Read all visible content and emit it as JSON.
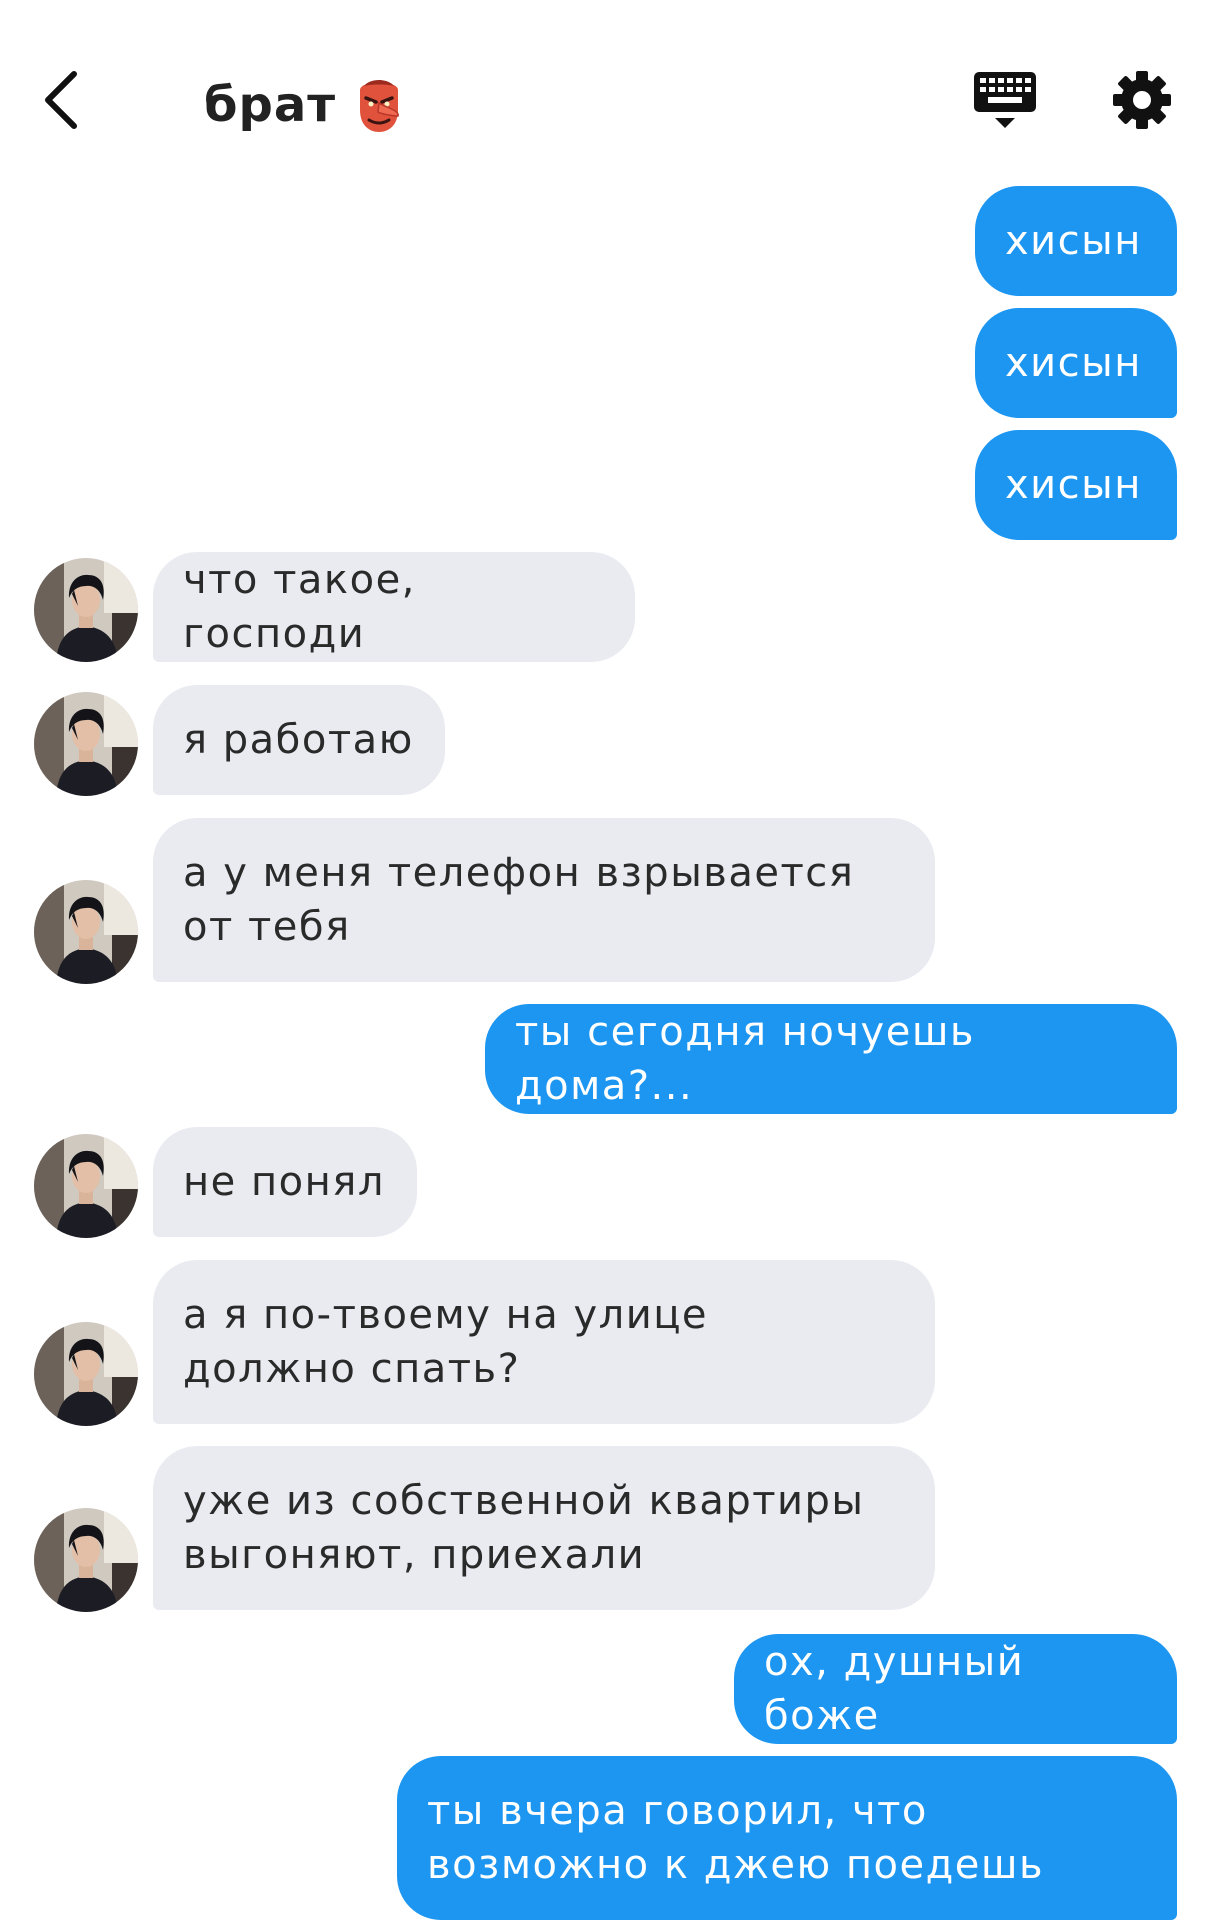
{
  "header": {
    "title": "брат",
    "title_emoji": "👺",
    "icons": {
      "back": "chevron-left-icon",
      "keyboard": "keyboard-icon",
      "settings": "gear-icon"
    }
  },
  "colors": {
    "outgoing_bubble": "#1c96f1",
    "incoming_bubble": "#e9ebf1",
    "outgoing_text": "#ffffff",
    "incoming_text": "#2a2a2a"
  },
  "messages": [
    {
      "from": "me",
      "text": "хисын"
    },
    {
      "from": "me",
      "text": "хисын"
    },
    {
      "from": "me",
      "text": "хисын"
    },
    {
      "from": "brother",
      "text": "что такое, господи"
    },
    {
      "from": "brother",
      "text": "я работаю"
    },
    {
      "from": "brother",
      "text": "а у меня телефон взрывается от тебя"
    },
    {
      "from": "me",
      "text": "ты сегодня ночуешь дома?..."
    },
    {
      "from": "brother",
      "text": "не понял"
    },
    {
      "from": "brother",
      "text": "а я по-твоему на улице должно спать?"
    },
    {
      "from": "brother",
      "text": "уже из собственной квартиры выгоняют, приехали"
    },
    {
      "from": "me",
      "text": "ох, душный боже"
    },
    {
      "from": "me",
      "text": "ты вчера говорил, что возможно к джею поедешь"
    }
  ]
}
